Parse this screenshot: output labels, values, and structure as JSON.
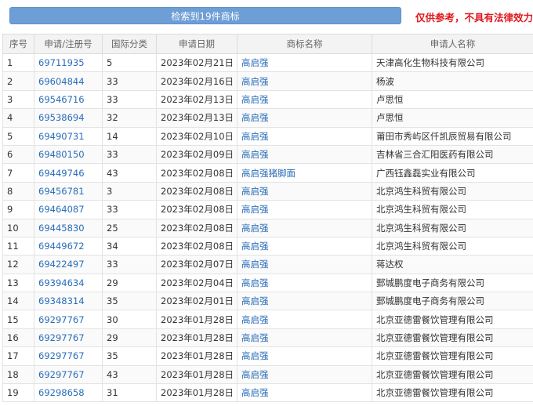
{
  "toolbar": {
    "result_label": "检索到19件商标",
    "disclaimer": "仅供参考，不具有法律效力"
  },
  "table": {
    "headers": [
      "序号",
      "申请/注册号",
      "国际分类",
      "申请日期",
      "商标名称",
      "申请人名称"
    ],
    "rows": [
      {
        "no": "1",
        "reg_no": "69711935",
        "class": "5",
        "date": "2023年02月21日",
        "mark": "高启强",
        "applicant": "天津高化生物科技有限公司"
      },
      {
        "no": "2",
        "reg_no": "69604844",
        "class": "33",
        "date": "2023年02月16日",
        "mark": "高启强",
        "applicant": "杨波"
      },
      {
        "no": "3",
        "reg_no": "69546716",
        "class": "33",
        "date": "2023年02月13日",
        "mark": "高启强",
        "applicant": "卢思恒"
      },
      {
        "no": "4",
        "reg_no": "69538694",
        "class": "32",
        "date": "2023年02月13日",
        "mark": "高启强",
        "applicant": "卢思恒"
      },
      {
        "no": "5",
        "reg_no": "69490731",
        "class": "14",
        "date": "2023年02月10日",
        "mark": "高启强",
        "applicant": "莆田市秀屿区仟凯辰贸易有限公司"
      },
      {
        "no": "6",
        "reg_no": "69480150",
        "class": "33",
        "date": "2023年02月09日",
        "mark": "高启强",
        "applicant": "吉林省三合汇阳医药有限公司"
      },
      {
        "no": "7",
        "reg_no": "69449746",
        "class": "43",
        "date": "2023年02月08日",
        "mark": "高启强猪脚面",
        "applicant": "广西钰鑫磊实业有限公司"
      },
      {
        "no": "8",
        "reg_no": "69456781",
        "class": "3",
        "date": "2023年02月08日",
        "mark": "高启强",
        "applicant": "北京鸿生科贸有限公司"
      },
      {
        "no": "9",
        "reg_no": "69464087",
        "class": "33",
        "date": "2023年02月08日",
        "mark": "高启强",
        "applicant": "北京鸿生科贸有限公司"
      },
      {
        "no": "10",
        "reg_no": "69445830",
        "class": "25",
        "date": "2023年02月08日",
        "mark": "高启强",
        "applicant": "北京鸿生科贸有限公司"
      },
      {
        "no": "11",
        "reg_no": "69449672",
        "class": "34",
        "date": "2023年02月08日",
        "mark": "高启强",
        "applicant": "北京鸿生科贸有限公司"
      },
      {
        "no": "12",
        "reg_no": "69422497",
        "class": "33",
        "date": "2023年02月07日",
        "mark": "高启强",
        "applicant": "蒋达权"
      },
      {
        "no": "13",
        "reg_no": "69394634",
        "class": "29",
        "date": "2023年02月04日",
        "mark": "高启强",
        "applicant": "鄄城鹏度电子商务有限公司"
      },
      {
        "no": "14",
        "reg_no": "69348314",
        "class": "35",
        "date": "2023年02月01日",
        "mark": "高启强",
        "applicant": "鄄城鹏度电子商务有限公司"
      },
      {
        "no": "15",
        "reg_no": "69297767",
        "class": "30",
        "date": "2023年01月28日",
        "mark": "高启强",
        "applicant": "北京亚德雷餐饮管理有限公司"
      },
      {
        "no": "16",
        "reg_no": "69297767",
        "class": "29",
        "date": "2023年01月28日",
        "mark": "高启强",
        "applicant": "北京亚德雷餐饮管理有限公司"
      },
      {
        "no": "17",
        "reg_no": "69297767",
        "class": "35",
        "date": "2023年01月28日",
        "mark": "高启强",
        "applicant": "北京亚德雷餐饮管理有限公司"
      },
      {
        "no": "18",
        "reg_no": "69297767",
        "class": "43",
        "date": "2023年01月28日",
        "mark": "高启强",
        "applicant": "北京亚德雷餐饮管理有限公司"
      },
      {
        "no": "19",
        "reg_no": "69298658",
        "class": "31",
        "date": "2023年01月28日",
        "mark": "高启强",
        "applicant": "北京亚德雷餐饮管理有限公司"
      }
    ]
  }
}
